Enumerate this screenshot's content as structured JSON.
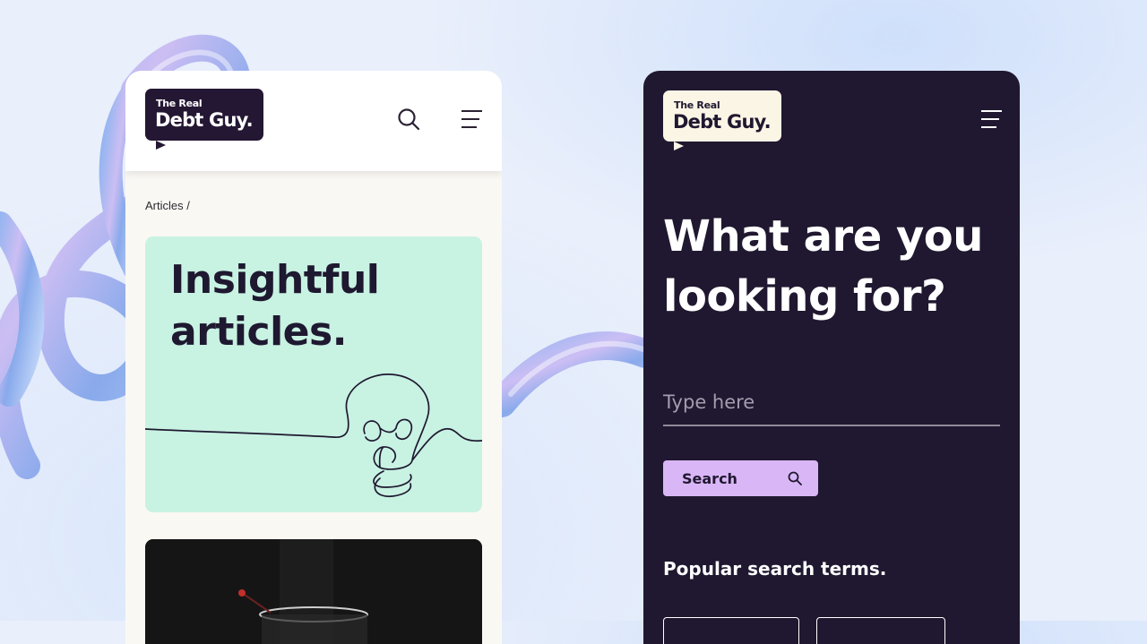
{
  "left_screen": {
    "logo": {
      "line1": "The Real",
      "line2": "Debt Guy."
    },
    "header_icons": [
      "search-icon",
      "hamburger-menu-icon"
    ],
    "breadcrumb": "Articles /",
    "hero_title": "Insightful articles."
  },
  "right_screen": {
    "logo": {
      "line1": "The Real",
      "line2": "Debt Guy."
    },
    "header_icons": [
      "hamburger-menu-icon"
    ],
    "heading": "What are you looking for?",
    "search_placeholder": "Type here",
    "search_button_label": "Search",
    "popular_heading": "Popular search terms."
  },
  "colors": {
    "brand_dark": "#241733",
    "screen_dark_bg": "#201830",
    "hero_mint": "#c8f2e2",
    "button_lavender": "#d9b6f6",
    "logo_cream": "#fbf5e6"
  }
}
